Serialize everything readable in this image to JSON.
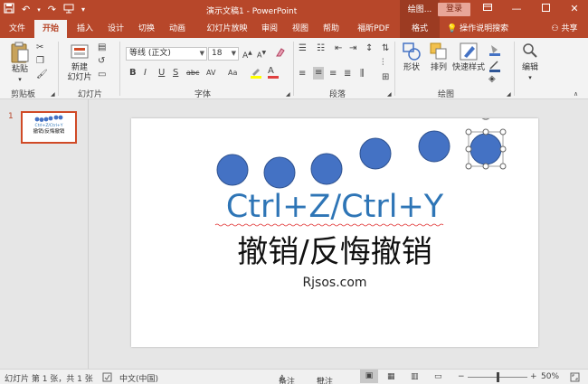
{
  "titlebar": {
    "document_title": "演示文稿1 - PowerPoint",
    "context_tab": "绘图...",
    "login_label": "登录",
    "qat_icons": [
      "save-icon",
      "undo-icon",
      "redo-icon",
      "slideshow-icon",
      "customize-qat-icon"
    ]
  },
  "tabs": [
    {
      "label": "文件"
    },
    {
      "label": "开始"
    },
    {
      "label": "插入"
    },
    {
      "label": "设计"
    },
    {
      "label": "切换"
    },
    {
      "label": "动画"
    },
    {
      "label": "幻灯片放映"
    },
    {
      "label": "审阅"
    },
    {
      "label": "视图"
    },
    {
      "label": "帮助"
    },
    {
      "label": "福昕PDF"
    },
    {
      "label": "格式"
    }
  ],
  "tell_me": "操作说明搜索",
  "share": "共享",
  "ribbon": {
    "paste": "粘贴",
    "new_slide_line1": "新建",
    "new_slide_line2": "幻灯片",
    "font_name": "等线 (正文)",
    "font_size": "18",
    "shape": "形状",
    "arrange": "排列",
    "quick_styles": "快速样式",
    "edit": "编辑",
    "groups": {
      "clipboard": "剪贴板",
      "slides": "幻灯片",
      "font": "字体",
      "paragraph": "段落",
      "drawing": "绘图"
    },
    "font_buttons": [
      "B",
      "I",
      "U",
      "S",
      "abc",
      "AV",
      "Aa",
      "A"
    ]
  },
  "thumbnail": {
    "number": "1",
    "text1": "Ctrl+Z/Ctrl+Y",
    "text2": "撤销/反悔撤销"
  },
  "slide": {
    "circle_color": "#4472c4",
    "line1": "Ctrl+Z/Ctrl+Y",
    "line1_color": "#2e75b6",
    "line2": "撤销/反悔撤销",
    "line3": "Rjsos.com"
  },
  "statusbar": {
    "slide_info": "幻灯片 第 1 张，共 1 张",
    "language": "中文(中国)",
    "notes": "备注",
    "comments": "批注",
    "zoom": "50%",
    "zoom_level": 0.5
  },
  "colors": {
    "brand": "#b7472a",
    "ribbon_bg": "#f3f3f3"
  }
}
